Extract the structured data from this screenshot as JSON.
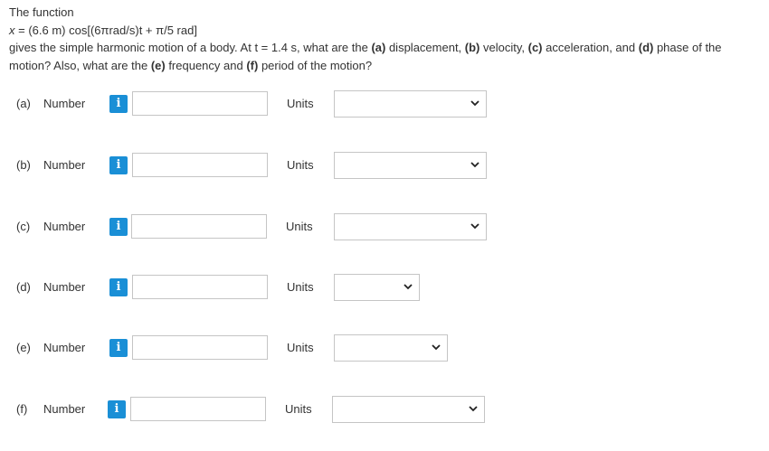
{
  "question": {
    "intro": "The function",
    "formula": {
      "var": "x",
      "rest": " = (6.6 m) cos[(6πrad/s)t + π/5 rad]"
    },
    "body": {
      "t1": "gives the simple harmonic motion of a body. At t = 1.4 s, what are the ",
      "a": "(a)",
      "t2": " displacement, ",
      "b": "(b)",
      "t3": " velocity, ",
      "c": "(c)",
      "t4": " acceleration, and ",
      "d": "(d)",
      "t5": " phase of the motion? Also, what are the ",
      "e": "(e)",
      "t6": " frequency and ",
      "f": "(f)",
      "t7": " period of the motion?"
    }
  },
  "rows": [
    {
      "letter": "(a)",
      "number_label": "Number",
      "info_icon": "i",
      "value": "",
      "units_label": "Units",
      "units_value": ""
    },
    {
      "letter": "(b)",
      "number_label": "Number",
      "info_icon": "i",
      "value": "",
      "units_label": "Units",
      "units_value": ""
    },
    {
      "letter": "(c)",
      "number_label": "Number",
      "info_icon": "i",
      "value": "",
      "units_label": "Units",
      "units_value": ""
    },
    {
      "letter": "(d)",
      "number_label": "Number",
      "info_icon": "i",
      "value": "",
      "units_label": "Units",
      "units_value": ""
    },
    {
      "letter": "(e)",
      "number_label": "Number",
      "info_icon": "i",
      "value": "",
      "units_label": "Units",
      "units_value": ""
    },
    {
      "letter": "(f)",
      "number_label": "Number",
      "info_icon": "i",
      "value": "",
      "units_label": "Units",
      "units_value": ""
    }
  ],
  "colors": {
    "info_button": "#1a8fd6",
    "text": "#333333",
    "border": "#c5c5c5"
  }
}
